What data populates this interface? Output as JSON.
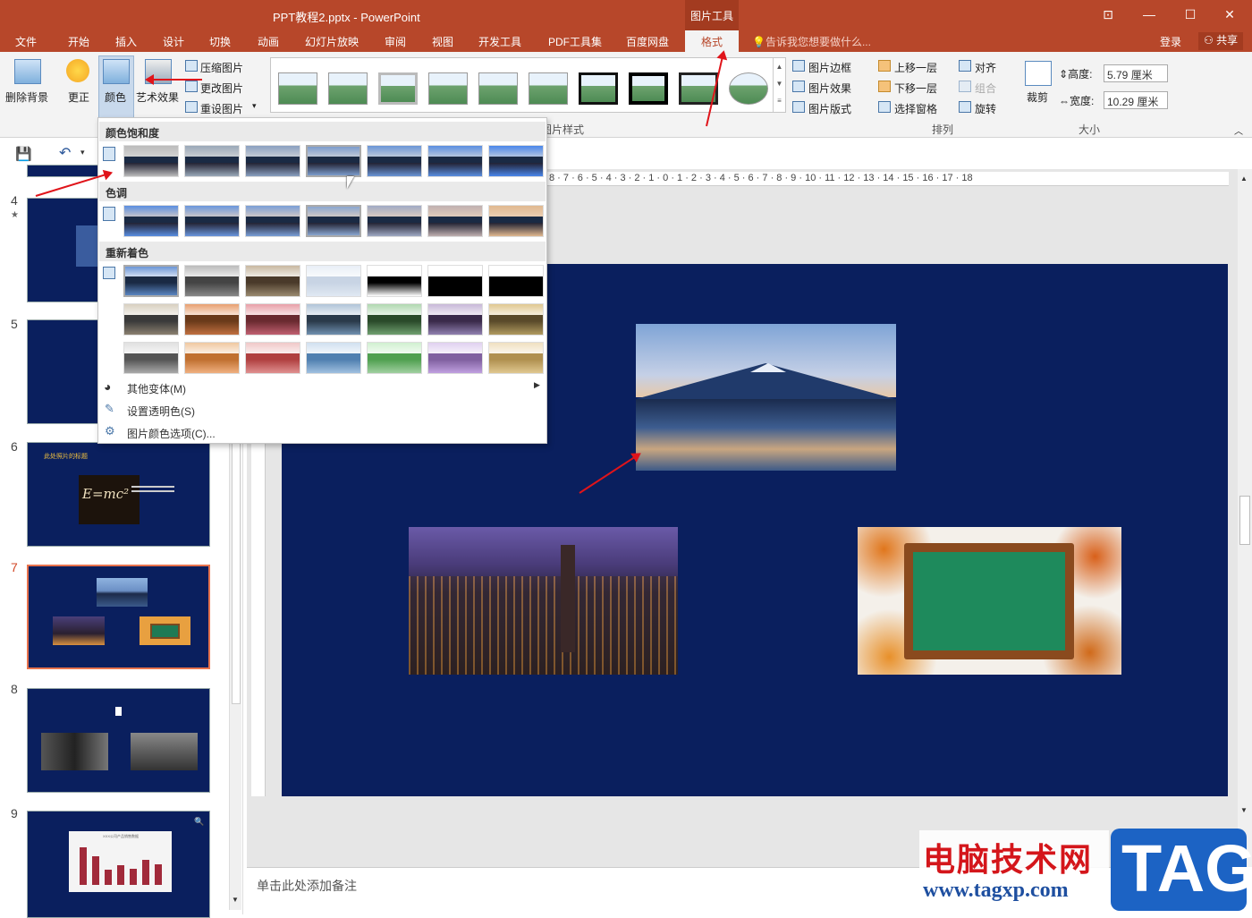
{
  "titlebar": {
    "title": "PPT教程2.pptx - PowerPoint",
    "context_group": "图片工具"
  },
  "tabs": [
    "文件",
    "开始",
    "插入",
    "设计",
    "切换",
    "动画",
    "幻灯片放映",
    "审阅",
    "视图",
    "开发工具",
    "PDF工具集",
    "百度网盘"
  ],
  "active_tab": "格式",
  "tell_me": "告诉我您想要做什么...",
  "signin": "登录",
  "share": "共享",
  "ribbon": {
    "remove_bg": "删除背景",
    "corrections": "更正",
    "color": "颜色",
    "artistic": "艺术效果",
    "compress": "压缩图片",
    "change_pic": "更改图片",
    "reset_pic": "重设图片",
    "styles_label": "图片样式",
    "border": "图片边框",
    "effects": "图片效果",
    "layout": "图片版式",
    "bring_forward": "上移一层",
    "send_backward": "下移一层",
    "selection_pane": "选择窗格",
    "align": "对齐",
    "group": "组合",
    "rotate": "旋转",
    "arrange_label": "排列",
    "crop": "裁剪",
    "height_label": "高度:",
    "height_value": "5.79 厘米",
    "width_label": "宽度:",
    "width_value": "10.29 厘米",
    "size_label": "大小"
  },
  "dropdown": {
    "saturation": "颜色饱和度",
    "tone": "色调",
    "recolor": "重新着色",
    "more_variations": "其他变体(M)",
    "set_transparent": "设置透明色(S)",
    "color_options": "图片颜色选项(C)..."
  },
  "slides": {
    "numbers": [
      "4",
      "5",
      "6",
      "7",
      "8",
      "9"
    ],
    "slide6_title": "此处照片的标题",
    "slide6_formula": "E=mc²",
    "slide9_chart_title": "XXX公司产品销售数据"
  },
  "notes_placeholder": "单击此处添加备注",
  "ruler_text": "8 · 7 · 6 · 5 · 4 · 3 · 2 · 1 · 0 · 1 · 2 · 3 · 4 · 5 · 6 · 7 · 8 · 9 · 10 · 11 · 12 · 13 · 14 · 15 · 16 · 17 · 18",
  "watermark": {
    "text": "电脑技术网",
    "url": "www.tagxp.com",
    "tag": "TAG"
  },
  "colors": {
    "accent": "#b7472a",
    "slide_bg": "#0a1f5e",
    "arrow": "#e0141a"
  }
}
